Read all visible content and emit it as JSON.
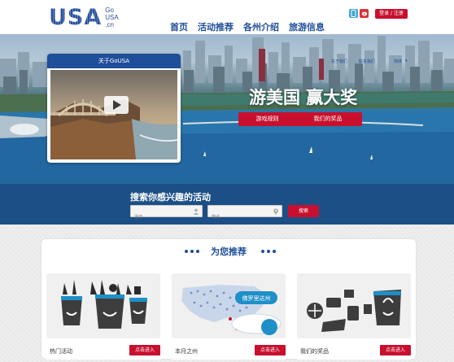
{
  "header": {
    "logo_text": "USA",
    "logo_sub": [
      "Go",
      "USA",
      ".cn"
    ],
    "nav": [
      "首页",
      "活动推荐",
      "各州介绍",
      "旅游信息"
    ],
    "login_label": "登录 / 注册",
    "phone_icon": "phone-icon",
    "weibo_icon": "weibo-icon"
  },
  "hero_subnav": {
    "about": "关于我们",
    "contact": "联系我们",
    "language": "简体"
  },
  "about_card": {
    "title": "关于GoUSA",
    "play_icon": "play-icon"
  },
  "promo": {
    "title": "游美国  赢大奖",
    "rules_label": "游戏规则",
    "prizes_label": "我们的奖品"
  },
  "search": {
    "title": "搜索你感兴趣的活动",
    "activity_placeholder": "活动",
    "location_placeholder": "地点",
    "button_label": "搜索"
  },
  "recommendations": {
    "title": "为您推荐",
    "cards": [
      {
        "label": "热门活动",
        "button": "点击进入"
      },
      {
        "label": "本月之州",
        "button": "点击进入",
        "badge": "佛罗里达州"
      },
      {
        "label": "我们的奖品",
        "button": "点击进入"
      }
    ]
  },
  "colors": {
    "brand_blue": "#1f4e9a",
    "accent_red": "#c8102e",
    "band_blue": "#1b4f86"
  }
}
